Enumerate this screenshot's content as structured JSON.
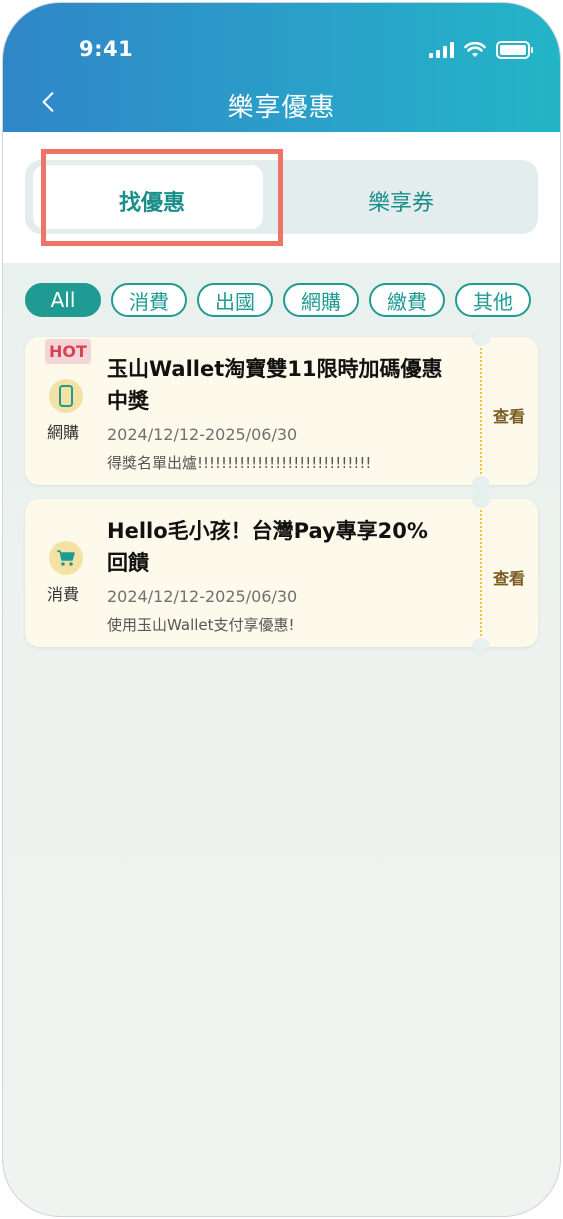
{
  "status_bar": {
    "time": "9:41"
  },
  "header": {
    "title": "樂享優惠"
  },
  "tabs": [
    {
      "label": "找優惠",
      "active": true
    },
    {
      "label": "樂享券",
      "active": false
    }
  ],
  "filters": [
    {
      "label": "All",
      "active": true
    },
    {
      "label": "消費",
      "active": false
    },
    {
      "label": "出國",
      "active": false
    },
    {
      "label": "網購",
      "active": false
    },
    {
      "label": "繳費",
      "active": false
    },
    {
      "label": "其他",
      "active": false
    }
  ],
  "offers": [
    {
      "badge": "HOT",
      "category": "網購",
      "category_icon": "phone-icon",
      "title_line1": "玉山Wallet淘寶雙11限時加碼優惠",
      "title_line2": "中獎",
      "date": "2024/12/12-2025/06/30",
      "description": "得獎名單出爐!!!!!!!!!!!!!!!!!!!!!!!!!!!!!",
      "action": "查看"
    },
    {
      "category": "消費",
      "category_icon": "cart-icon",
      "title_line1": "Hello毛小孩！台灣Pay專享20%",
      "title_line2": "回饋",
      "date": "2024/12/12-2025/06/30",
      "description": "使用玉山Wallet支付享優惠!",
      "action": "查看"
    }
  ],
  "colors": {
    "accent": "#1f9b93",
    "header_start": "#2f86c8",
    "header_end": "#22b5c6",
    "highlight": "#ee7468"
  }
}
